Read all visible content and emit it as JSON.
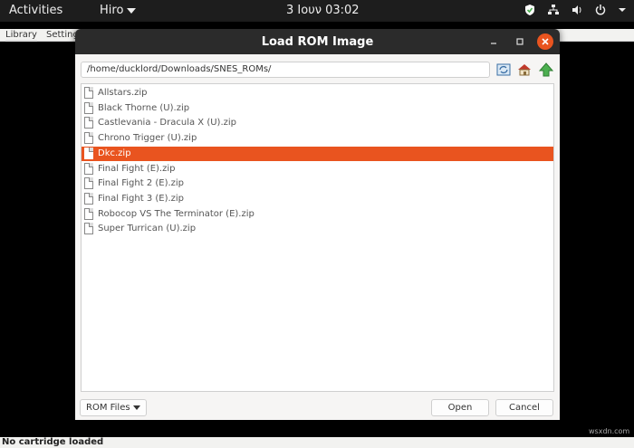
{
  "topbar": {
    "activities": "Activities",
    "app_menu": "Hiro",
    "clock": "3 Ιουν  03:02",
    "icons": [
      "shield-icon",
      "network-icon",
      "volume-icon",
      "power-icon",
      "chevron-down-icon"
    ]
  },
  "app": {
    "menus": [
      "Library",
      "Settings"
    ],
    "status": "No cartridge loaded"
  },
  "dialog": {
    "title": "Load ROM Image",
    "path": "/home/ducklord/Downloads/SNES_ROMs/",
    "files": [
      "Allstars.zip",
      "Black Thorne (U).zip",
      "Castlevania - Dracula X (U).zip",
      "Chrono Trigger (U).zip",
      "Dkc.zip",
      "Final Fight (E).zip",
      "Final Fight 2 (E).zip",
      "Final Fight 3 (E).zip",
      "Robocop VS The Terminator (E).zip",
      "Super Turrican (U).zip"
    ],
    "selected_index": 4,
    "filter": "ROM Files",
    "open_label": "Open",
    "cancel_label": "Cancel"
  },
  "watermark": "wsxdn.com",
  "colors": {
    "accent": "#e9541f",
    "topbar": "#1d1d1d",
    "titlebar": "#2b2b2b"
  }
}
